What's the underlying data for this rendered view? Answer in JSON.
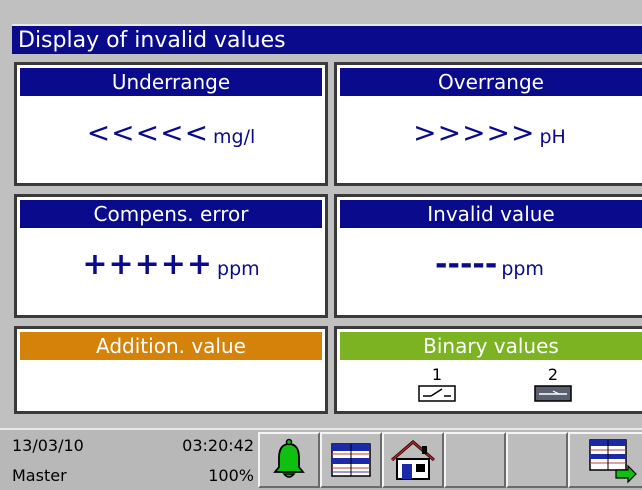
{
  "window": {
    "title": "Display of invalid values"
  },
  "panels": {
    "underrange": {
      "header": "Underrange",
      "symbol": "<<<<<",
      "unit": "mg/l",
      "header_color": "#0a0a8c"
    },
    "overrange": {
      "header": "Overrange",
      "symbol": ">>>>>",
      "unit": "pH",
      "header_color": "#0a0a8c"
    },
    "compens_error": {
      "header": "Compens. error",
      "symbol": "+++++",
      "unit": "ppm",
      "header_color": "#0a0a8c"
    },
    "invalid_value": {
      "header": "Invalid value",
      "symbol": "-----",
      "unit": "ppm",
      "header_color": "#0a0a8c"
    },
    "addition_value": {
      "header": "Addition. value",
      "header_color": "#d4820a"
    },
    "binary_values": {
      "header": "Binary values",
      "header_color": "#7cb322",
      "channels": [
        {
          "num": "1",
          "state": "open"
        },
        {
          "num": "2",
          "state": "closed"
        }
      ]
    }
  },
  "statusbar": {
    "date": "13/03/10",
    "time": "03:20:42",
    "user": "Master",
    "percent": "100%",
    "buttons": [
      "alarm-bell-icon",
      "table-grid-icon",
      "home-icon",
      "empty",
      "empty",
      "table-export-icon"
    ]
  },
  "colors": {
    "navy": "#0a0a8c",
    "orange": "#d4820a",
    "green": "#7cb322",
    "bell": "#10c010"
  }
}
